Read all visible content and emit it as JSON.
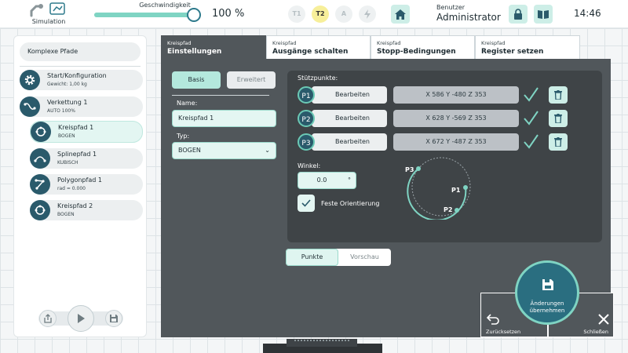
{
  "topbar": {
    "simulation_label": "Simulation",
    "speed_label": "Geschwindigkeit",
    "speed_fraction": 1.0,
    "speed_value": "100 %",
    "mode_buttons": [
      "T1",
      "T2",
      "A"
    ],
    "active_mode": "T2",
    "user_role": "Benutzer",
    "user_name": "Administrator",
    "clock": "14:46",
    "icons": [
      "simulation-icon",
      "power-icon",
      "home-icon",
      "lock-icon",
      "book-icon"
    ]
  },
  "sidebar": {
    "program_title": "Komplexe Pfade",
    "nodes": [
      {
        "title": "Start/Konfiguration",
        "subtitle": "Gewicht: 1,00 kg",
        "icon": "gear-icon"
      },
      {
        "title": "Verkettung 1",
        "subtitle": "AUTO  100%",
        "icon": "chain-path-icon"
      },
      {
        "title": "Kreispfad 1",
        "subtitle": "BOGEN",
        "icon": "circle-path-icon"
      },
      {
        "title": "Splinepfad 1",
        "subtitle": "KUBISCH",
        "icon": "spline-path-icon"
      },
      {
        "title": "Polygonpfad 1",
        "subtitle": "rad = 0.000",
        "icon": "polygon-path-icon"
      },
      {
        "title": "Kreispfad 2",
        "subtitle": "BOGEN",
        "icon": "circle-path-icon"
      }
    ],
    "controls": [
      "export-icon",
      "play-icon",
      "save-icon"
    ]
  },
  "tabs": [
    {
      "small": "Kreispfad",
      "label": "Einstellungen",
      "active": true
    },
    {
      "small": "Kreispfad",
      "label": "Ausgänge schalten",
      "active": false
    },
    {
      "small": "Kreispfad",
      "label": "Stopp-Bedingungen",
      "active": false
    },
    {
      "small": "Kreispfad",
      "label": "Register setzen",
      "active": false
    }
  ],
  "settings": {
    "mode_basic": "Basis",
    "mode_advanced": "Erweitert",
    "name_label": "Name:",
    "name_value": "Kreispfad 1",
    "type_label": "Typ:",
    "type_value": "BOGEN"
  },
  "points": {
    "label": "Stützpunkte:",
    "edit_label": "Bearbeiten",
    "items": [
      {
        "id": "P1",
        "coord": "X 586 Y -480 Z 353"
      },
      {
        "id": "P2",
        "coord": "X 628 Y -569 Z 353"
      },
      {
        "id": "P3",
        "coord": "X 672 Y -487 Z 353"
      }
    ]
  },
  "angle": {
    "label": "Winkel:",
    "value": "0.0",
    "unit": "°"
  },
  "orientation": {
    "label": "Feste Orientierung",
    "checked": true
  },
  "preview": {
    "labels": [
      "P3",
      "P1",
      "P2"
    ]
  },
  "view_toggle": {
    "points": "Punkte",
    "preview": "Vorschau"
  },
  "actions": {
    "apply_line1": "Änderungen",
    "apply_line2": "übernehmen",
    "reset": "Zurücksetzen",
    "close": "Schließen"
  },
  "colors": {
    "accent": "#7fd4c3",
    "primary": "#2a5a6b",
    "panel": "#51575b"
  }
}
